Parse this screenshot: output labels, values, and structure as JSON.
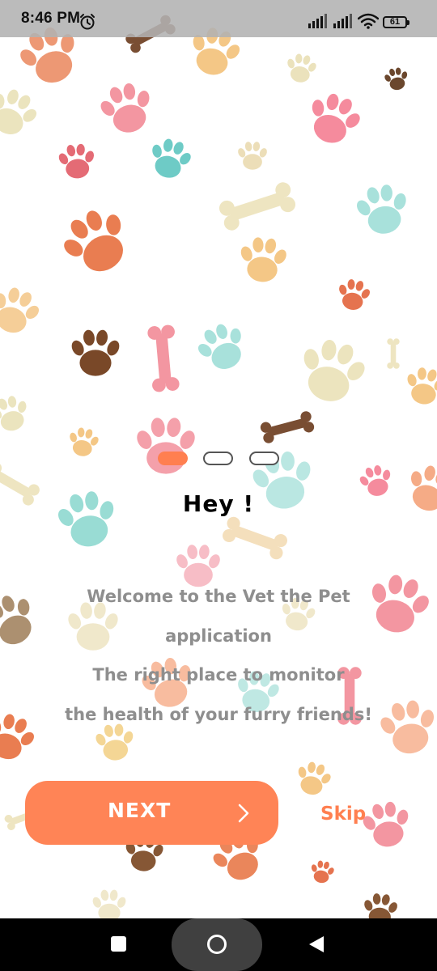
{
  "status_bar": {
    "time": "8:46 PM",
    "battery_level": "61",
    "icons": [
      "alarm-icon",
      "signal-icon",
      "signal-icon",
      "wifi-icon",
      "battery-icon"
    ]
  },
  "onboarding": {
    "page_indicator": {
      "total_pages": 3,
      "active_page": 1
    },
    "headline": "Hey !",
    "welcome_lines": [
      "Welcome to the Vet the Pet",
      "application",
      "The right place to monitor",
      "the health of your furry friends!"
    ],
    "next_button": {
      "label": "NEXT",
      "icon": "chevron-right-icon"
    },
    "skip_label": "Skip"
  },
  "navigation_bar": {
    "icons": [
      "recent-apps-icon",
      "home-icon",
      "back-icon"
    ]
  },
  "colors": {
    "accent": "#ff7f50",
    "button_background": "#ff8456",
    "body_text": "#8e8e8e",
    "headline_text": "#000000",
    "status_bar": "#b2b2b2",
    "nav_bar": "#000000"
  }
}
